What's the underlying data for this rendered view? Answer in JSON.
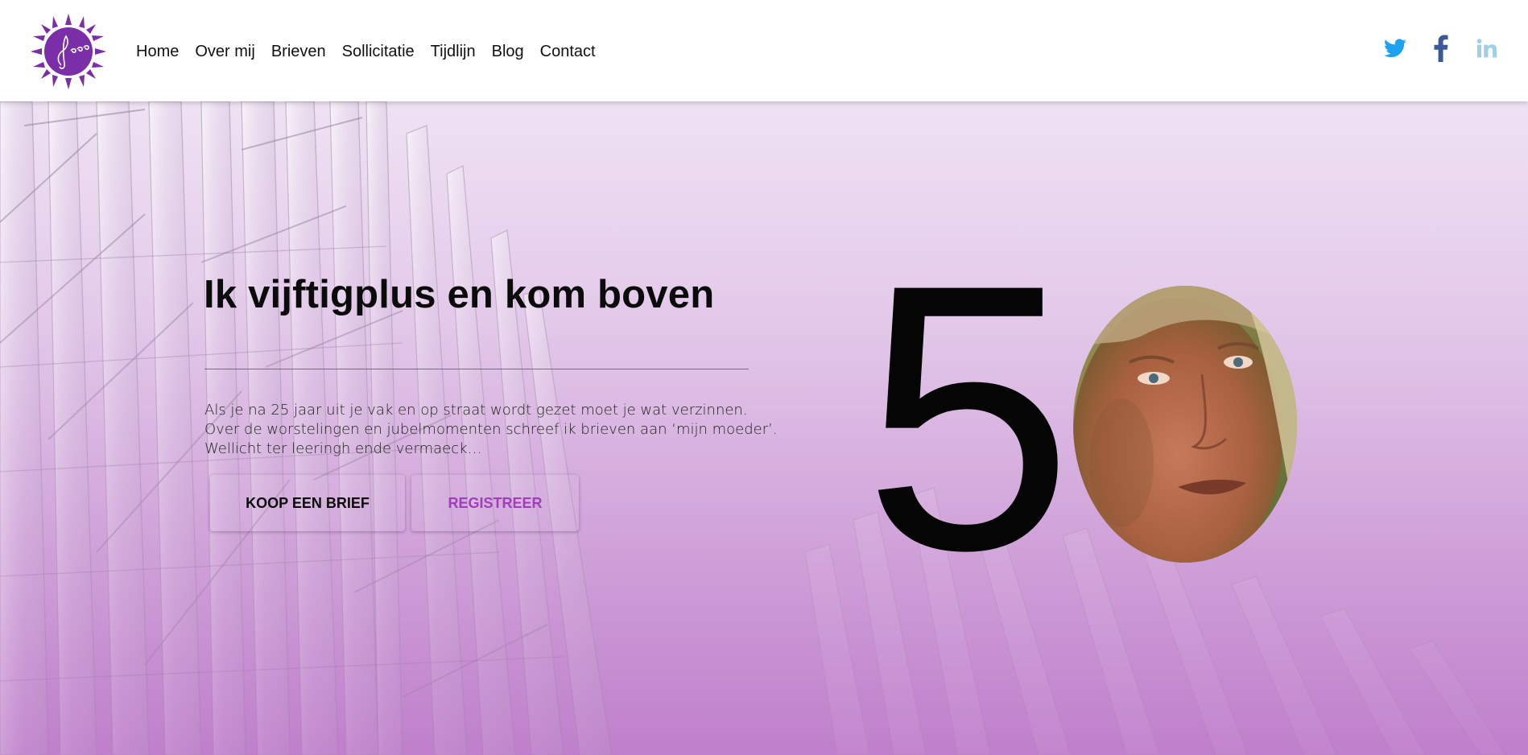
{
  "nav": {
    "items": [
      "Home",
      "Over mij",
      "Brieven",
      "Sollicitatie",
      "Tijdlijn",
      "Blog",
      "Contact"
    ]
  },
  "social": {
    "icons": [
      "twitter-icon",
      "facebook-icon",
      "linkedin-icon"
    ],
    "colors": {
      "twitter": "#1da1f2",
      "facebook": "#3b5998",
      "linkedin": "#9fd0e8"
    }
  },
  "hero": {
    "title": "Ik vijftigplus en kom boven",
    "intro_lines": [
      "Als je na 25 jaar uit je vak en op straat wordt gezet moet je wat verzinnen.",
      "Over de worstelingen en jubelmomenten schreef ik brieven aan ‘mijn moeder’.",
      "Wellicht ter leeringh ende vermaeck…"
    ],
    "buy_button": "KOOP EEN BRIEF",
    "register_button": "REGISTREER",
    "big_number": "5"
  },
  "colors": {
    "accent": "#a040b8",
    "logo": "#7a2fa8"
  }
}
